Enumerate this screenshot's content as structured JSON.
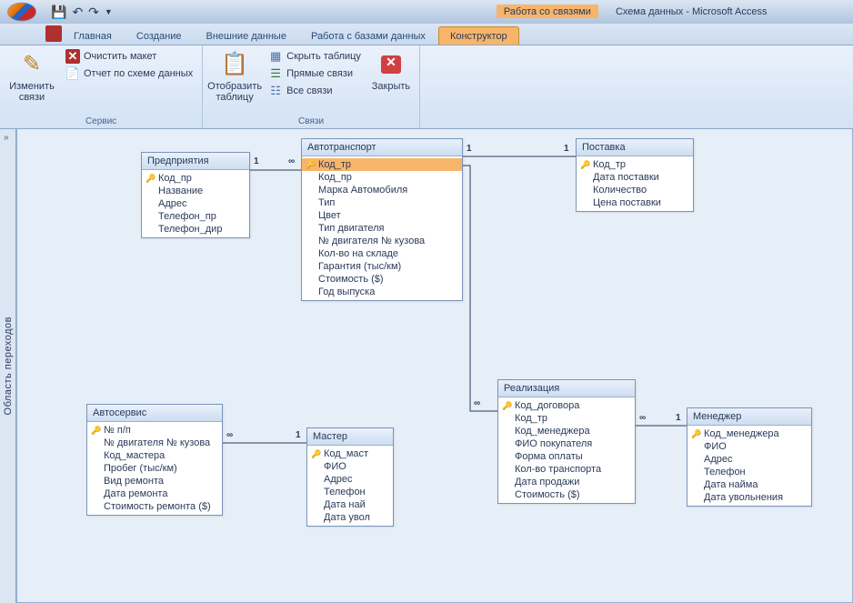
{
  "title": {
    "contextTab": "Работа со связями",
    "document": "Схема данных - Microsoft Access"
  },
  "tabs": [
    "Главная",
    "Создание",
    "Внешние данные",
    "Работа с базами данных",
    "Конструктор"
  ],
  "activeTab": 4,
  "ribbon": {
    "group1": {
      "label": "Сервис",
      "editRel": "Изменить связи",
      "clear": "Очистить макет",
      "report": "Отчет по схеме данных"
    },
    "group2": {
      "label": "Связи",
      "showTable": "Отобразить таблицу",
      "hideTable": "Скрыть таблицу",
      "direct": "Прямые связи",
      "all": "Все связи",
      "close": "Закрыть"
    }
  },
  "sidepane": "Область переходов",
  "tables": {
    "t1": {
      "title": "Предприятия",
      "fields": [
        {
          "n": "Код_пр",
          "k": true
        },
        {
          "n": "Название"
        },
        {
          "n": "Адрес"
        },
        {
          "n": "Телефон_пр"
        },
        {
          "n": "Телефон_дир"
        }
      ]
    },
    "t2": {
      "title": "Автотранспорт",
      "fields": [
        {
          "n": "Код_тр",
          "k": true,
          "sel": true
        },
        {
          "n": "Код_пр"
        },
        {
          "n": "Марка Автомобиля"
        },
        {
          "n": "Тип"
        },
        {
          "n": "Цвет"
        },
        {
          "n": "Тип двигателя"
        },
        {
          "n": "№ двигателя № кузова"
        },
        {
          "n": "Кол-во на складе"
        },
        {
          "n": "Гарантия  (тыс/км)"
        },
        {
          "n": "Стоимость ($)"
        },
        {
          "n": "Год выпуска"
        }
      ]
    },
    "t3": {
      "title": "Поставка",
      "fields": [
        {
          "n": "Код_тр",
          "k": true
        },
        {
          "n": "Дата поставки"
        },
        {
          "n": "Количество"
        },
        {
          "n": "Цена поставки"
        }
      ]
    },
    "t4": {
      "title": "Автосервис",
      "fields": [
        {
          "n": "№ п/п",
          "k": true
        },
        {
          "n": "№ двигателя № кузова"
        },
        {
          "n": "Код_мастера"
        },
        {
          "n": "Пробег (тыс/км)"
        },
        {
          "n": "Вид ремонта"
        },
        {
          "n": "Дата ремонта"
        },
        {
          "n": "Стоимость ремонта ($)"
        }
      ]
    },
    "t5": {
      "title": "Мастер",
      "fields": [
        {
          "n": "Код_маст",
          "k": true
        },
        {
          "n": "ФИО"
        },
        {
          "n": "Адрес"
        },
        {
          "n": "Телефон"
        },
        {
          "n": "Дата най"
        },
        {
          "n": "Дата увол"
        }
      ]
    },
    "t6": {
      "title": "Реализация",
      "fields": [
        {
          "n": "Код_договора",
          "k": true
        },
        {
          "n": "Код_тр"
        },
        {
          "n": "Код_менеджера"
        },
        {
          "n": "ФИО покупателя"
        },
        {
          "n": "Форма оплаты"
        },
        {
          "n": "Кол-во транспорта"
        },
        {
          "n": "Дата продажи"
        },
        {
          "n": "Стоимость ($)"
        }
      ]
    },
    "t7": {
      "title": "Менеджер",
      "fields": [
        {
          "n": "Код_менеджера",
          "k": true
        },
        {
          "n": "ФИО"
        },
        {
          "n": "Адрес"
        },
        {
          "n": "Телефон"
        },
        {
          "n": "Дата найма"
        },
        {
          "n": "Дата увольнения"
        }
      ]
    }
  },
  "relLabels": {
    "one": "1",
    "many": "∞"
  }
}
